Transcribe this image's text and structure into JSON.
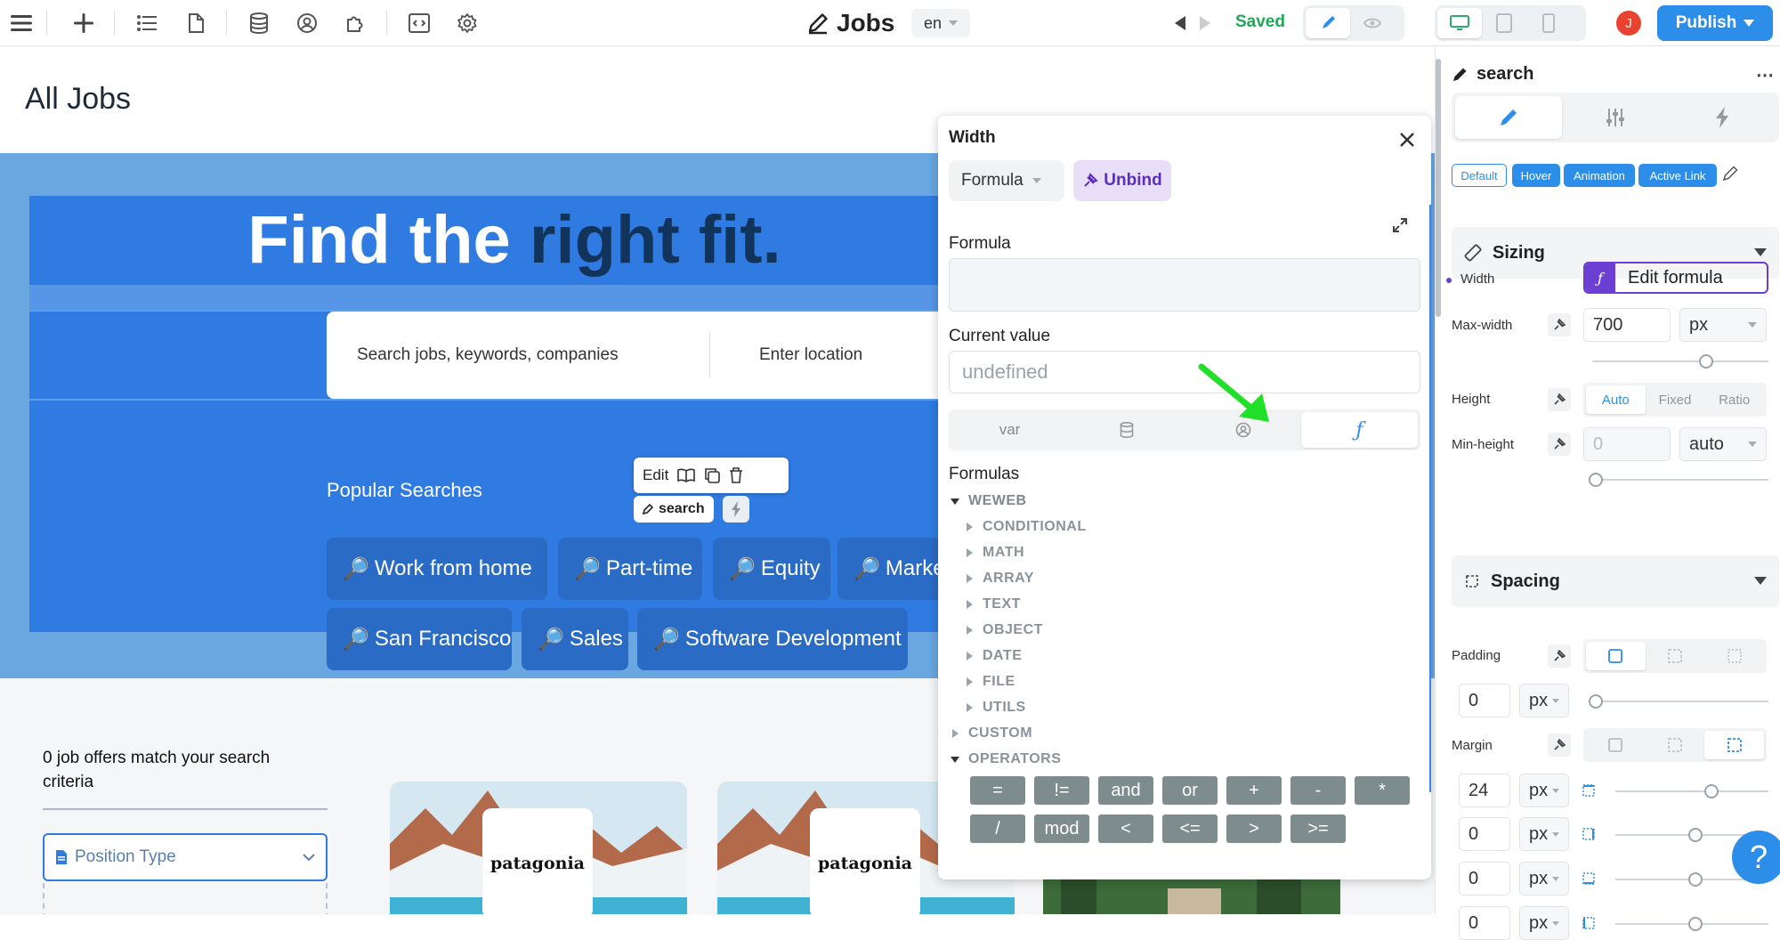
{
  "topbar": {
    "page_title": "Jobs",
    "language": "en",
    "saved_label": "Saved",
    "avatar_initial": "J",
    "publish_label": "Publish",
    "icons": [
      "menu-icon",
      "plus-icon",
      "list-icon",
      "page-icon",
      "database-icon",
      "user-circle-icon",
      "puzzle-icon",
      "code-icon",
      "gear-icon",
      "pencil-icon",
      "undo-icon",
      "redo-icon",
      "brush-icon",
      "eye-icon",
      "desktop-icon",
      "tablet-icon",
      "mobile-icon"
    ]
  },
  "canvas": {
    "page_heading": "All Jobs",
    "hero": {
      "headline_start": "Find the ",
      "headline_highlight": "right fit.",
      "search_placeholder": "Search jobs, keywords, companies",
      "location_placeholder": "Enter location",
      "popular_label": "Popular Searches",
      "chips": [
        "Work from home",
        "Part-time",
        "Equity",
        "Marketing",
        "San Francisco",
        "Sales",
        "Software Development"
      ]
    },
    "edit_toolbar": {
      "edit_label": "Edit"
    },
    "element_tag": "search",
    "results": {
      "match_text": "0 job offers match your search criteria",
      "filter_label": "Position Type"
    },
    "cards": [
      {
        "logo": "patagonia"
      },
      {
        "logo": "patagonia"
      },
      {
        "logo": ""
      }
    ]
  },
  "formula_popup": {
    "title": "Width",
    "mode": "Formula",
    "unbind_label": "Unbind",
    "formula_label": "Formula",
    "formula_value": "",
    "current_value_label": "Current value",
    "current_value": "undefined",
    "tabs": [
      "var",
      "database",
      "user",
      "ƒ"
    ],
    "formulas_label": "Formulas",
    "tree": {
      "weweb": "WEWEB",
      "children": [
        "CONDITIONAL",
        "MATH",
        "ARRAY",
        "TEXT",
        "OBJECT",
        "DATE",
        "FILE",
        "UTILS"
      ],
      "custom": "CUSTOM",
      "operators": "OPERATORS"
    },
    "operators": [
      "=",
      "!=",
      "and",
      "or",
      "+",
      "-",
      "*",
      "/",
      "mod",
      "<",
      "<=",
      ">",
      ">="
    ]
  },
  "right_panel": {
    "element_name": "search",
    "more_label": "⋯",
    "states": [
      "Default",
      "Hover",
      "Animation",
      "Active Link"
    ],
    "sizing": {
      "title": "Sizing",
      "width_label": "Width",
      "edit_formula_label": "Edit formula",
      "max_width_label": "Max-width",
      "max_width_value": "700",
      "max_width_unit": "px",
      "height_label": "Height",
      "height_options": [
        "Auto",
        "Fixed",
        "Ratio"
      ],
      "min_height_label": "Min-height",
      "min_height_value": "0",
      "min_height_unit": "auto"
    },
    "spacing": {
      "title": "Spacing",
      "padding_label": "Padding",
      "padding_value": "0",
      "padding_unit": "px",
      "margin_label": "Margin",
      "margin_values": [
        "24",
        "0",
        "0",
        "0"
      ],
      "margin_unit": "px"
    }
  },
  "help_label": "?",
  "colors": {
    "accent": "#2d8eea",
    "hero": "#2f7be2",
    "saved": "#1fa855",
    "formula": "#6b3fd4"
  }
}
